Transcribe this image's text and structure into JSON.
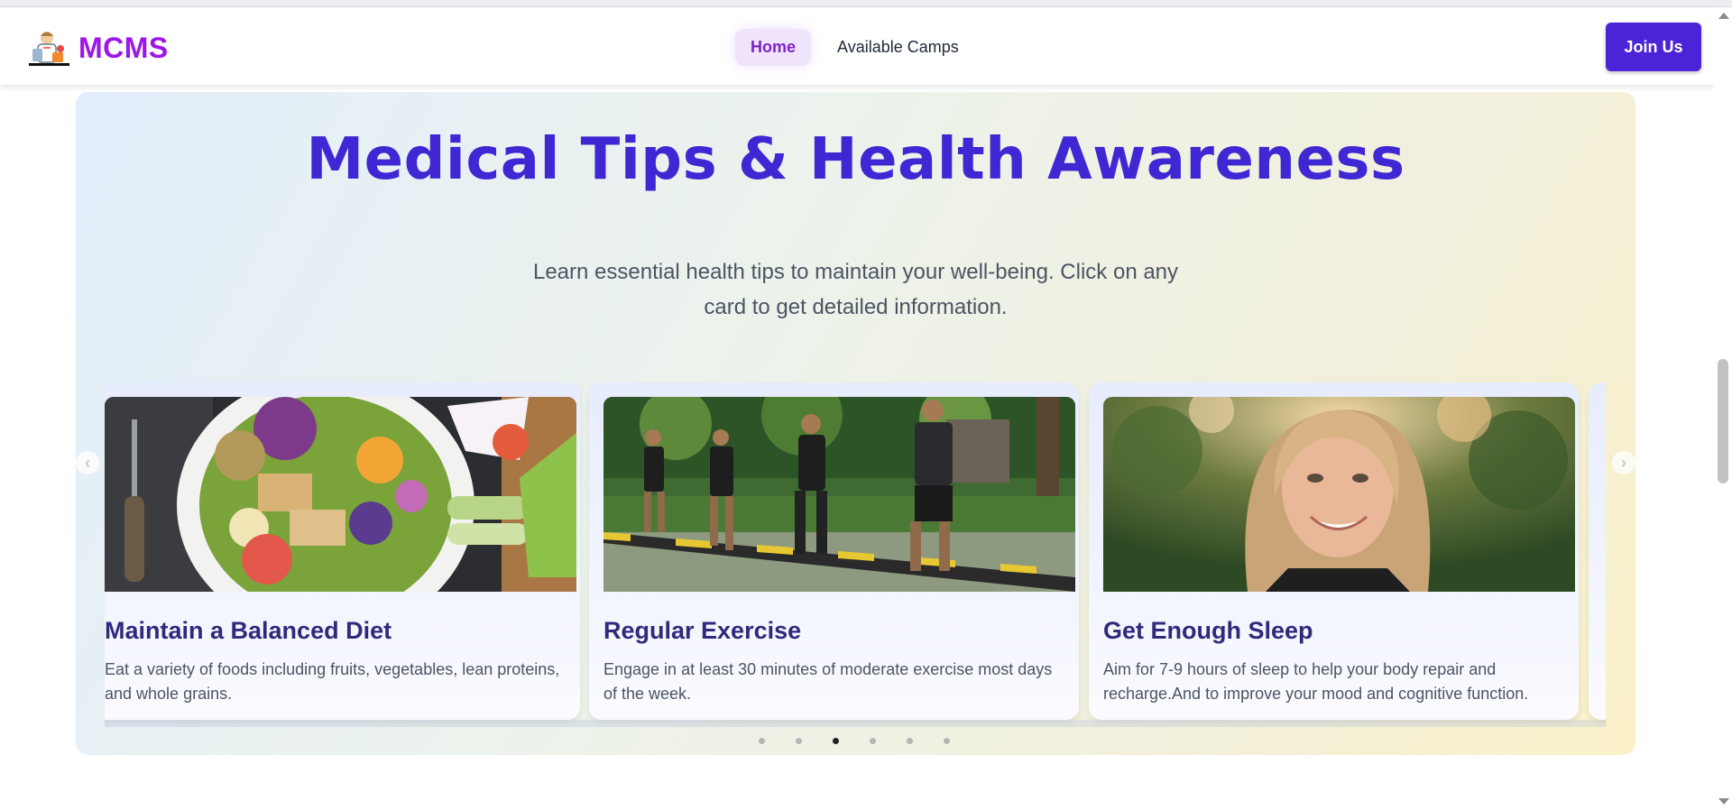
{
  "header": {
    "brand": "MCMS",
    "nav": [
      {
        "label": "Home",
        "active": true
      },
      {
        "label": "Available Camps",
        "active": false
      }
    ],
    "join_label": "Join Us"
  },
  "section": {
    "title": "Medical Tips & Health Awareness",
    "description": "Learn essential health tips to maintain your well-being. Click on any card to get detailed information."
  },
  "cards": [
    {
      "title": "Maintain a Balanced Diet",
      "text": "Eat a variety of foods including fruits, vegetables, lean proteins, and whole grains.",
      "image": "salad-bowl-photo"
    },
    {
      "title": "Regular Exercise",
      "text": "Engage in at least 30 minutes of moderate exercise most days of the week.",
      "image": "runners-photo"
    },
    {
      "title": "Get Enough Sleep",
      "text": "Aim for 7-9 hours of sleep to help your body repair and recharge.And to improve your mood and cognitive function.",
      "image": "smiling-woman-photo"
    }
  ],
  "carousel": {
    "prev_icon": "chevron-left-icon",
    "next_icon": "chevron-right-icon",
    "dots": 6,
    "active_dot": 3
  },
  "colors": {
    "brand": "#9c16e8",
    "primary": "#4a24d6",
    "title": "#3f27d3"
  }
}
